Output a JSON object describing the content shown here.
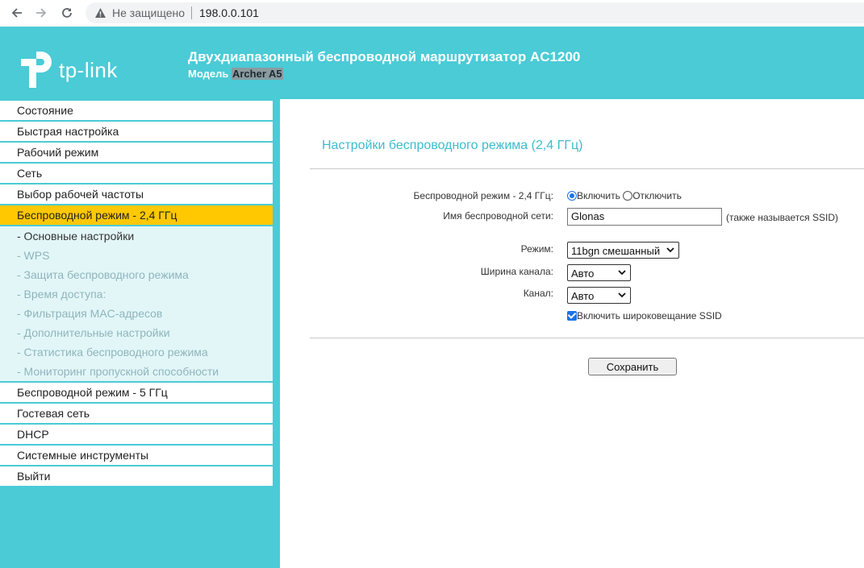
{
  "browser": {
    "security_text": "Не защищено",
    "url": "198.0.0.101"
  },
  "header": {
    "logo_text": "tp-link",
    "title": "Двухдиапазонный беспроводной маршрутизатор AC1200",
    "model_label": "Модель",
    "model_name": "Archer A5"
  },
  "sidebar": {
    "items_before": [
      {
        "label": "Состояние"
      },
      {
        "label": "Быстрая настройка"
      },
      {
        "label": "Рабочий режим"
      },
      {
        "label": "Сеть"
      },
      {
        "label": "Выбор рабочей частоты"
      }
    ],
    "active_item": {
      "label": "Беспроводной режим - 2,4 ГГц"
    },
    "submenu": [
      {
        "label": "- Основные настройки",
        "current": true
      },
      {
        "label": "- WPS"
      },
      {
        "label": "- Защита беспроводного режима"
      },
      {
        "label": "- Время доступа:"
      },
      {
        "label": "- Фильтрация MAC-адресов"
      },
      {
        "label": "- Дополнительные настройки"
      },
      {
        "label": "- Статистика беспроводного режима"
      },
      {
        "label": "- Мониторинг пропускной способности"
      }
    ],
    "items_after": [
      {
        "label": "Беспроводной режим - 5 ГГц"
      },
      {
        "label": "Гостевая сеть"
      },
      {
        "label": "DHCP"
      },
      {
        "label": "Системные инструменты"
      },
      {
        "label": "Выйти"
      }
    ]
  },
  "main": {
    "page_title": "Настройки беспроводного режима (2,4 ГГц)",
    "wireless_label": "Беспроводной режим - 2,4 ГГц:",
    "enable_label": "Включить",
    "disable_label": "Отключить",
    "wireless_enabled": true,
    "ssid_label": "Имя беспроводной сети:",
    "ssid_value": "Glonas",
    "ssid_hint": "(также называется SSID)",
    "mode_label": "Режим:",
    "mode_value": "11bgn смешанный",
    "width_label": "Ширина канала:",
    "width_value": "Авто",
    "channel_label": "Канал:",
    "channel_value": "Авто",
    "broadcast_label": "Включить широковещание SSID",
    "broadcast_checked": true,
    "save_label": "Сохранить"
  },
  "colors": {
    "brand": "#4acbd6",
    "active": "#ffc801",
    "title": "#3dbccc",
    "control_accent": "#1a73e8"
  }
}
